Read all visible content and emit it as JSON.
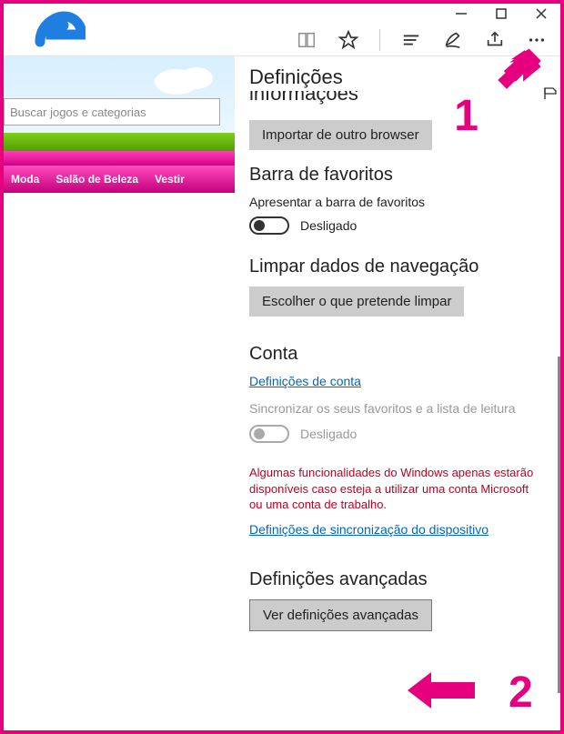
{
  "window": {
    "controls": {
      "minimize": "–",
      "maximize": "▢",
      "close": "✕"
    }
  },
  "toolbar": {
    "icons": [
      "reading-list-icon",
      "favorite-icon",
      "hub-icon",
      "note-icon",
      "share-icon",
      "more-icon"
    ]
  },
  "page": {
    "search_placeholder": "Buscar jogos e categorias",
    "menu": [
      "Moda",
      "Salão de Beleza",
      "Vestir"
    ]
  },
  "settings": {
    "title": "Definições",
    "cut_section": "informações",
    "import_btn": "Importar de outro browser",
    "fav_section": "Barra de favoritos",
    "fav_label": "Apresentar a barra de favoritos",
    "fav_toggle_state": "Desligado",
    "clear_section": "Limpar dados de navegação",
    "clear_btn": "Escolher o que pretende limpar",
    "account_section": "Conta",
    "account_link": "Definições de conta",
    "sync_label": "Sincronizar os seus favoritos e a lista de leitura",
    "sync_toggle_state": "Desligado",
    "sync_note": "Algumas funcionalidades do Windows apenas estarão disponíveis caso esteja a utilizar uma conta Microsoft ou uma conta de trabalho.",
    "device_sync_link": "Definições de sincronização do dispositivo",
    "advanced_section": "Definições avançadas",
    "advanced_btn": "Ver definições avançadas"
  },
  "annotations": {
    "n1": "1",
    "n2": "2"
  }
}
